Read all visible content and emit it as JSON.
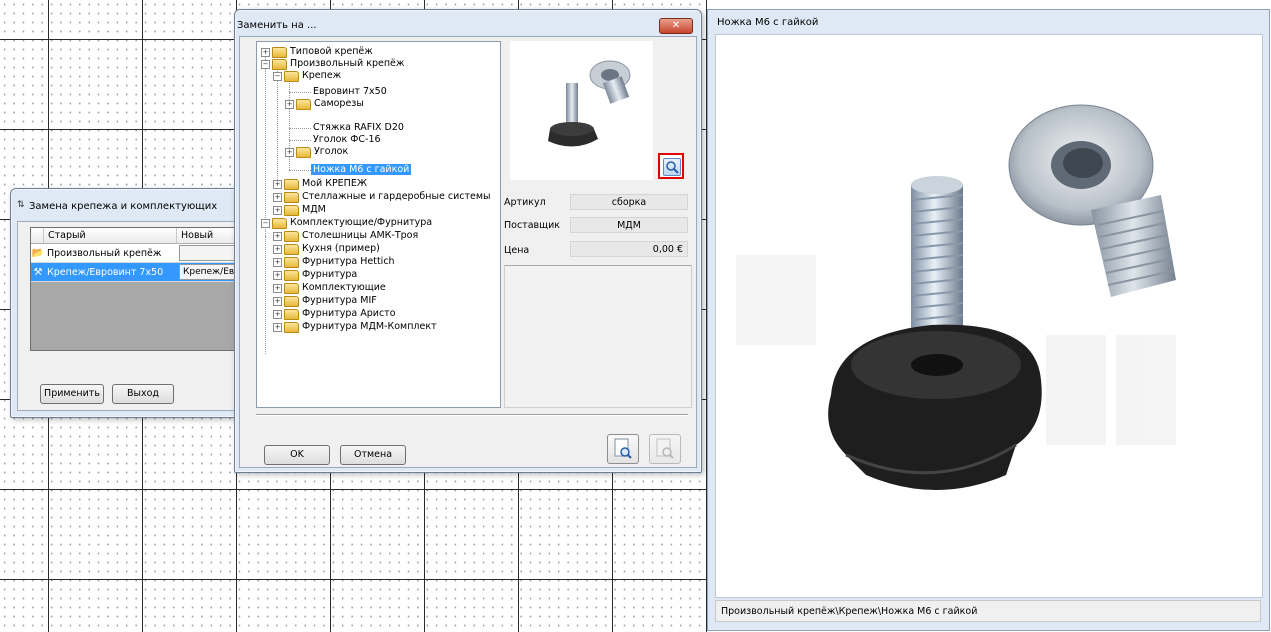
{
  "left_dialog": {
    "title": "Замена крепежа и комплектующих",
    "columns": [
      "Старый",
      "Новый"
    ],
    "rows": [
      {
        "old": "Произвольный крепёж",
        "new": ""
      },
      {
        "old": "Крепеж/Евровинт 7х50",
        "new": "Крепеж/Евровинт"
      }
    ],
    "apply_label": "Применить",
    "exit_label": "Выход"
  },
  "replace_dialog": {
    "title": "Заменить на ...",
    "close_glyph": "✕",
    "tree": [
      {
        "label": "Типовой крепёж"
      },
      {
        "label": "Произвольный крепёж"
      },
      {
        "label": "Крепеж"
      },
      {
        "label": "Евровинт 7х50"
      },
      {
        "label": "Саморезы"
      },
      {
        "label": "Стяжка RAFIX D20"
      },
      {
        "label": "Уголок ФС-16"
      },
      {
        "label": "Уголок"
      },
      {
        "label": "Ножка М6 с гайкой"
      },
      {
        "label": "Мой КРЕПЕЖ"
      },
      {
        "label": "Стеллажные и гардеробные системы"
      },
      {
        "label": "МДМ"
      },
      {
        "label": "Комплектующие/Фурнитура"
      },
      {
        "label": "Столешницы АМК-Троя"
      },
      {
        "label": "Кухня (пример)"
      },
      {
        "label": "Фурнитура Hettich"
      },
      {
        "label": "Фурнитура"
      },
      {
        "label": "Комплектующие"
      },
      {
        "label": "Фурнитура MIF"
      },
      {
        "label": "Фурнитура Аристо"
      },
      {
        "label": "Фурнитура МДМ-Комплект"
      }
    ],
    "props": {
      "article_label": "Артикул",
      "article_value": "сборка",
      "supplier_label": "Поставщик",
      "supplier_value": "МДМ",
      "price_label": "Цена",
      "price_value": "0,00 €"
    },
    "ok_label": "OK",
    "cancel_label": "Отмена"
  },
  "image_window": {
    "title": "Ножка М6 с гайкой",
    "status_path": "Произвольный крепёж\\Крепеж\\Ножка М6 с гайкой"
  },
  "colors": {
    "selection": "#3399ff",
    "highlight_border": "#e00000",
    "window_frame": "#dfe9f5"
  }
}
